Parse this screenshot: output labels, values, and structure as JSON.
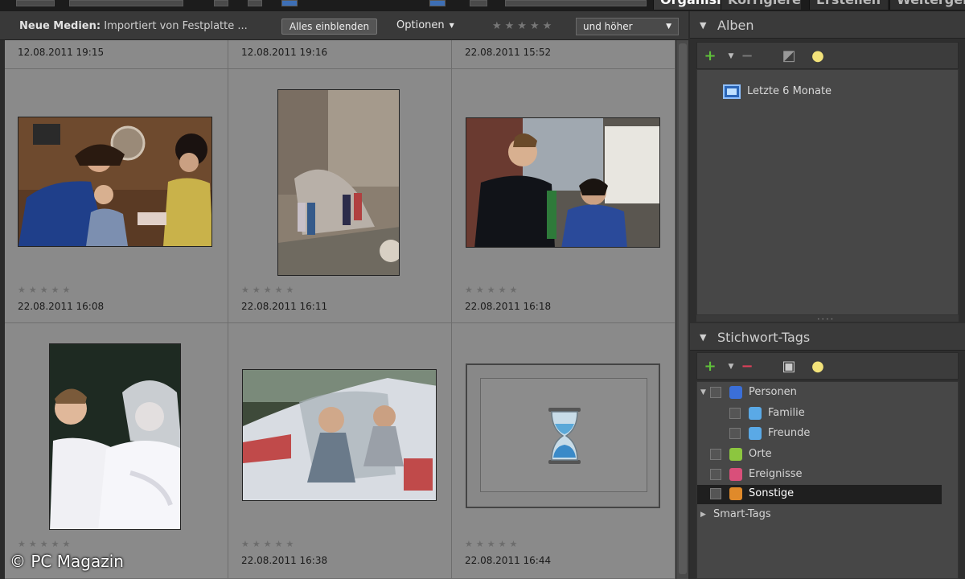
{
  "topbar": {
    "tabs": [
      {
        "label": "Organisieren",
        "active": true
      },
      {
        "label": "Korrigieren",
        "active": false
      },
      {
        "label": "Erstellen",
        "active": false
      },
      {
        "label": "Weitergeben",
        "active": false
      }
    ]
  },
  "media_bar": {
    "label_bold": "Neue Medien:",
    "label_source": "Importiert von Festplatte ...",
    "show_all": "Alles einblenden",
    "options": "Optionen",
    "rating_select": "und höher"
  },
  "grid": {
    "top_dates": [
      "12.08.2011 19:15",
      "12.08.2011 19:16",
      "22.08.2011 15:52"
    ],
    "row1_dates": [
      "22.08.2011 16:08",
      "22.08.2011 16:11",
      "22.08.2011 16:18"
    ],
    "row2_dates": [
      "22.08.2011 16:38",
      "22.08.2011 16:44"
    ],
    "star_glyphs": "★★★★★",
    "loading_icon": "hourglass-icon"
  },
  "albums": {
    "title": "Alben",
    "items": [
      {
        "label": "Letzte 6 Monate",
        "icon": "album-icon"
      }
    ]
  },
  "tags": {
    "title": "Stichwort-Tags",
    "items": [
      {
        "label": "Personen",
        "color": "#3b6fd8"
      },
      {
        "label": "Familie",
        "color": "#5aa9e6"
      },
      {
        "label": "Freunde",
        "color": "#5aa9e6"
      },
      {
        "label": "Orte",
        "color": "#8cc63f"
      },
      {
        "label": "Ereignisse",
        "color": "#d94f7a"
      },
      {
        "label": "Sonstige",
        "color": "#e08a2a"
      }
    ],
    "smart_tags": "Smart-Tags"
  },
  "watermark": "© PC Magazin"
}
